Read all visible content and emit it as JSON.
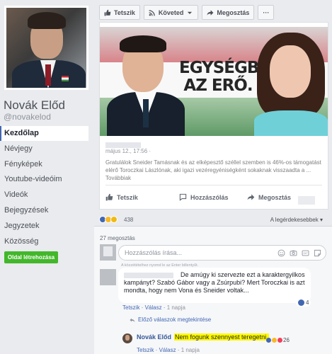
{
  "profile": {
    "name": "Novák Előd",
    "handle": "@novakelod"
  },
  "nav": {
    "items": [
      {
        "label": "Kezdőlap",
        "active": true
      },
      {
        "label": "Névjegy"
      },
      {
        "label": "Fényképek"
      },
      {
        "label": "Youtube-videóim"
      },
      {
        "label": "Videók"
      },
      {
        "label": "Bejegyzések"
      },
      {
        "label": "Jegyzetek"
      },
      {
        "label": "Közösség"
      }
    ],
    "create_page": "Oldal létrehozása"
  },
  "topbar": {
    "like": "Tetszik",
    "follow": "Követed",
    "share": "Megosztás",
    "more": "···"
  },
  "post": {
    "banner_slogan_line1": "EGYSÉGBEN",
    "banner_slogan_line2": "AZ ERŐ.",
    "date": "május 12., 17:56 · ",
    "text": "Gratulálok Sneider Tamásnak és az elképesztő széllel szemben is 46%-os támogatást elérő Toroczkai Lászlónak, aki igazi vezéregyéniségként sokaknak visszaadta a ... Továbbiak",
    "actions": {
      "like": "Tetszik",
      "comment": "Hozzászólás",
      "share": "Megosztás"
    }
  },
  "reactions": {
    "count": "438",
    "sort": "A legérdekesebbek"
  },
  "comments": {
    "shares": "27 megosztás",
    "composer_placeholder": "Hozzászólás írása...",
    "composer_hint": "A közzétételhez nyomd le az Enter billentyűt.",
    "c1": {
      "text": "De amúgy ki szervezte ezt a karaktergyilkos kampányt? Szabó Gábor vagy a Zsúrpubi? Mert Toroczkai is azt mondta, hogy nem Vona és Sneider voltak...",
      "like": "Tetszik",
      "reply": "Válasz",
      "time": "1 napja",
      "reactions": "4"
    },
    "earlier_replies": "Előző válaszok megtekintése",
    "c2": {
      "name": "Novák Előd",
      "text": "Nem fogunk szennyest teregetni.",
      "reactions": "26",
      "like": "Tetszik",
      "reply": "Válasz",
      "time": "1 napja"
    }
  },
  "colors": {
    "brand_blue": "#4267b2",
    "create_green": "#42b72a",
    "highlight_yellow": "#fff900"
  }
}
